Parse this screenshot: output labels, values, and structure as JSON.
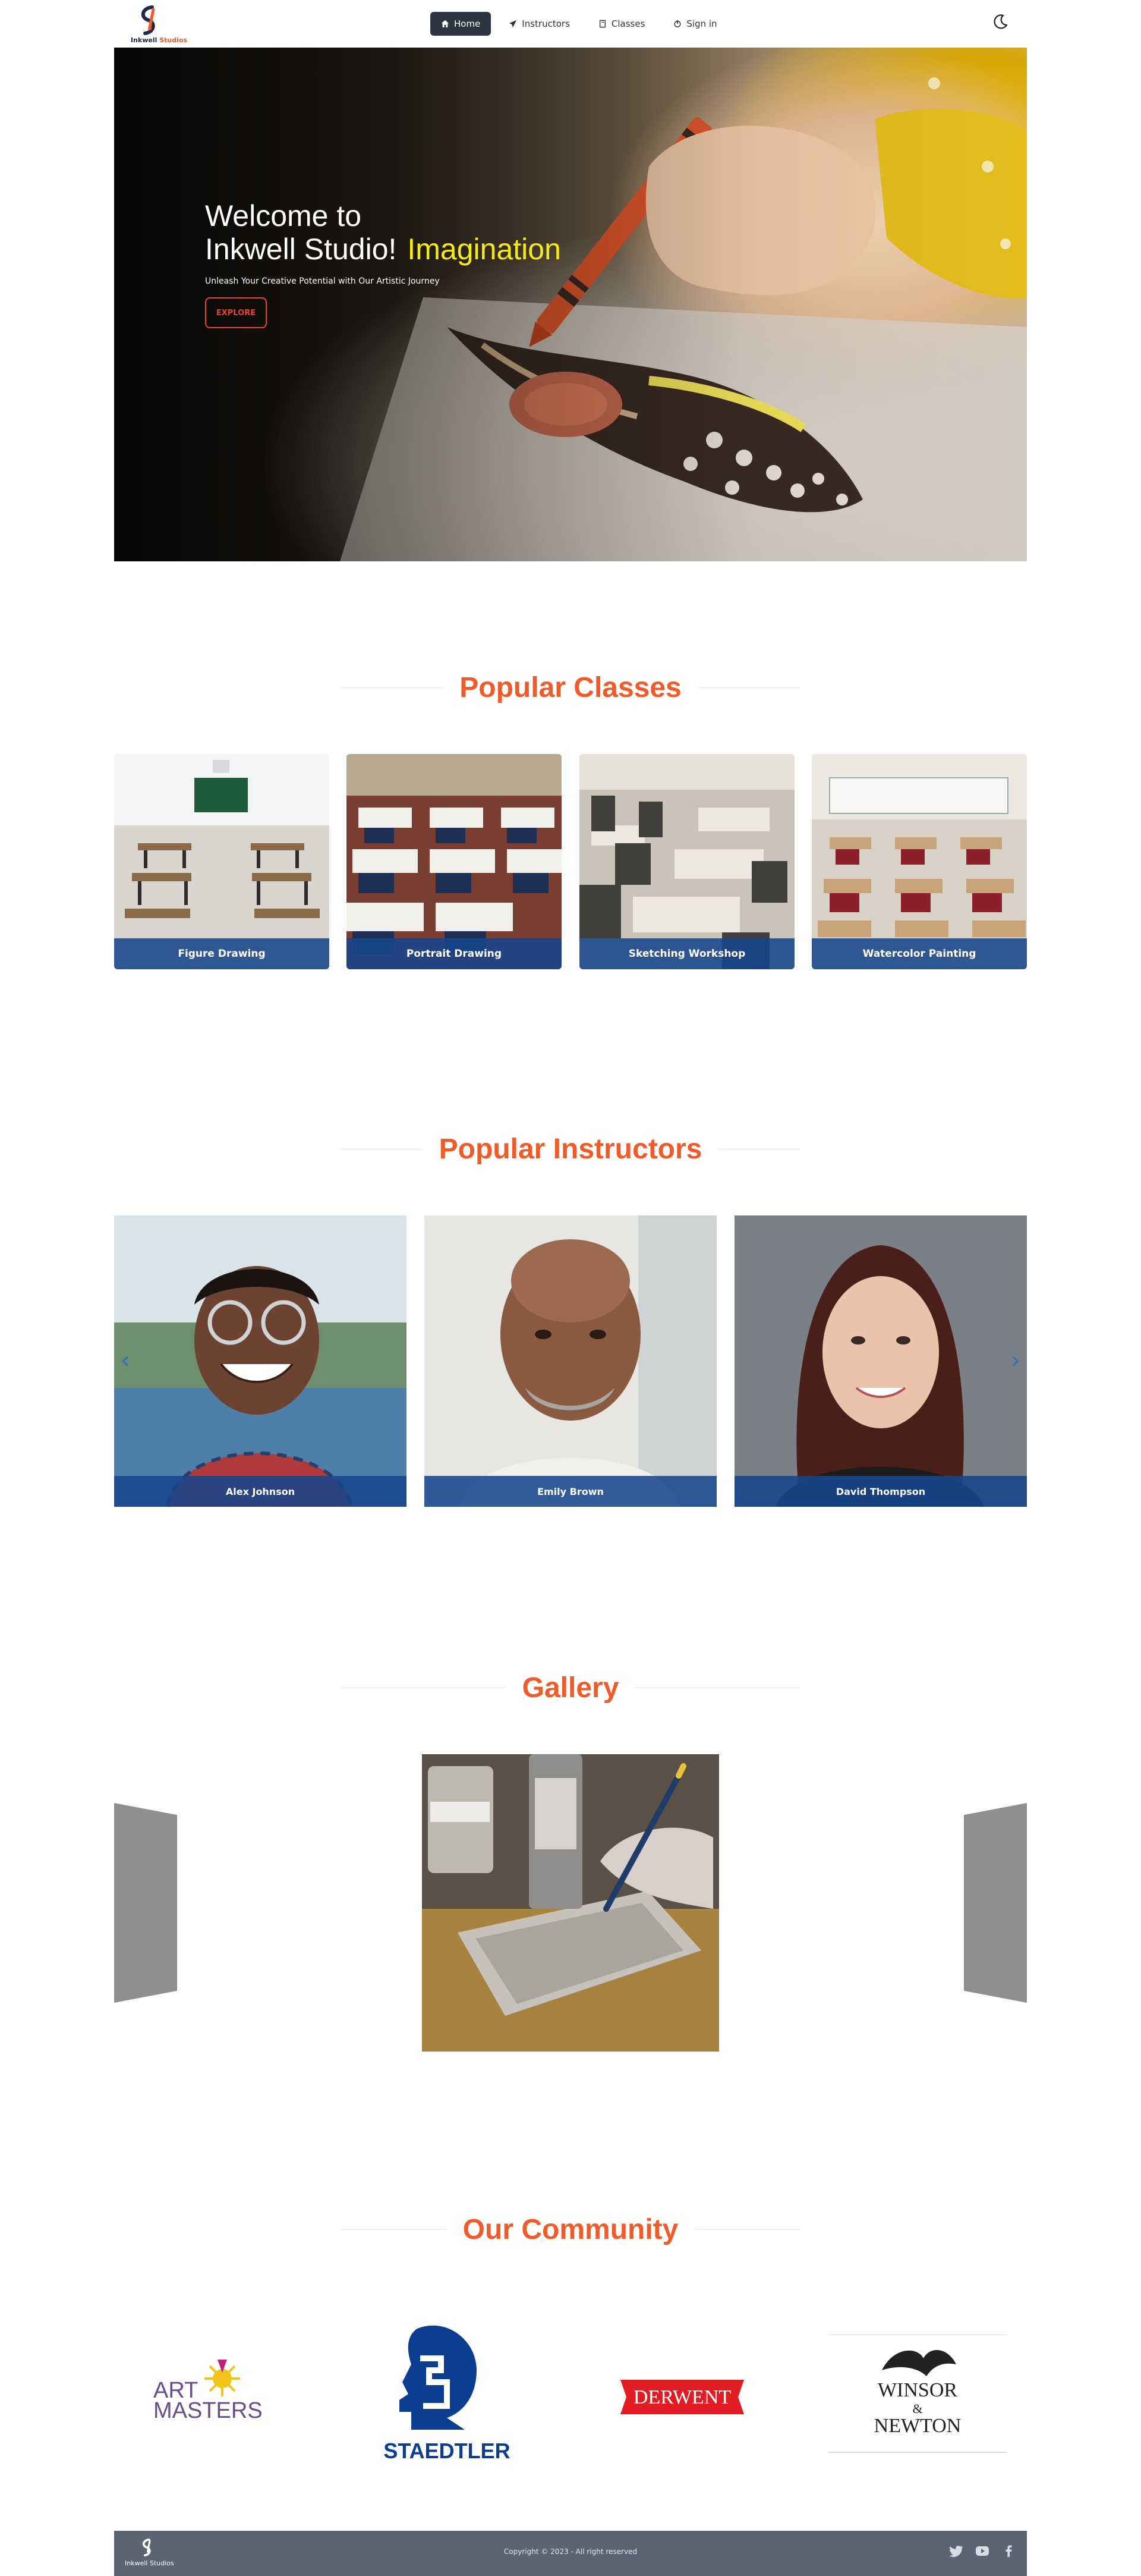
{
  "nav": {
    "logo_text_1": "Inkwell",
    "logo_text_2": "Studios",
    "items": [
      {
        "label": "Home",
        "icon": "home-icon",
        "active": true
      },
      {
        "label": "Instructors",
        "icon": "paper-plane-icon",
        "active": false
      },
      {
        "label": "Classes",
        "icon": "book-icon",
        "active": false
      },
      {
        "label": "Sign in",
        "icon": "power-icon",
        "active": false
      }
    ],
    "theme_toggle_icon": "moon-icon"
  },
  "hero": {
    "title_line1": "Welcome to",
    "title_line2": "Inkwell Studio!",
    "highlight": "Imagination",
    "subtitle": "Unleash Your Creative Potential with Our Artistic Journey",
    "button": "EXPLORE"
  },
  "classes": {
    "heading": "Popular Classes",
    "items": [
      {
        "name": "Figure Drawing"
      },
      {
        "name": "Portrait Drawing"
      },
      {
        "name": "Sketching Workshop"
      },
      {
        "name": "Watercolor Painting"
      }
    ]
  },
  "instructors": {
    "heading": "Popular Instructors",
    "items": [
      {
        "name": "Alex Johnson"
      },
      {
        "name": "Emily Brown"
      },
      {
        "name": "David Thompson"
      }
    ],
    "prev_arrow": "‹",
    "next_arrow": "›"
  },
  "gallery": {
    "heading": "Gallery"
  },
  "community": {
    "heading": "Our Community",
    "brands": [
      {
        "name": "ART MASTERS",
        "line1": "ART",
        "line2": "MASTERS"
      },
      {
        "name": "STAEDTLER"
      },
      {
        "name": "DERWENT"
      },
      {
        "name": "WINSOR & NEWTON",
        "line1": "WINSOR",
        "line2": "&",
        "line3": "NEWTON"
      }
    ]
  },
  "footer": {
    "logo_text": "Inkwell Studios",
    "copyright": "Copyright © 2023 - All right reserved",
    "socials": [
      "twitter-icon",
      "youtube-icon",
      "facebook-icon"
    ]
  },
  "colors": {
    "accent": "#f15a29",
    "nav_active": "#2d3441",
    "caption_blue": "#17468c",
    "footer_bg": "#5a6573",
    "hero_highlight": "#f6ea14"
  }
}
